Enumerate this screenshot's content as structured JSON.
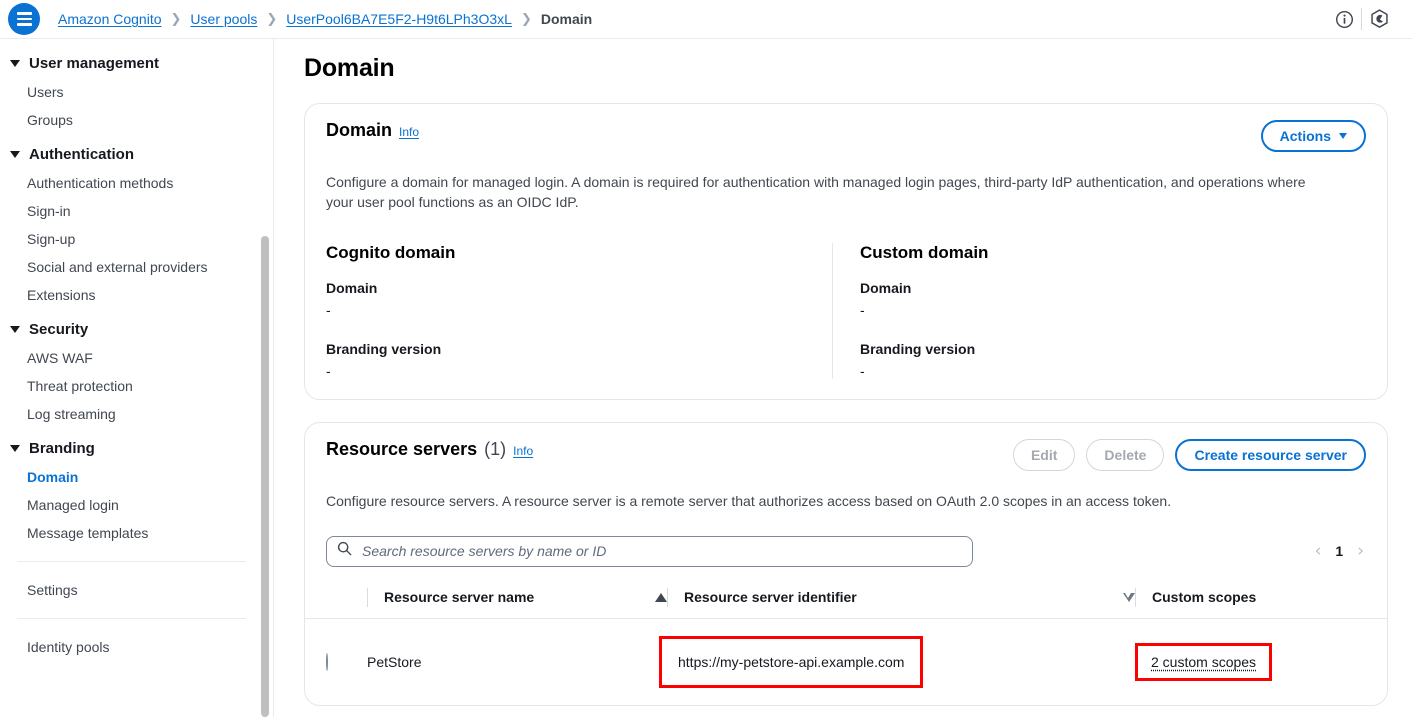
{
  "topbar": {
    "logo_name": "aws-cognito-menu-logo",
    "breadcrumbs": [
      {
        "label": "Amazon Cognito",
        "type": "link"
      },
      {
        "label": "User pools",
        "type": "link"
      },
      {
        "label": "UserPool6BA7E5F2-H9t6LPh3O3xL",
        "type": "link"
      },
      {
        "label": "Domain",
        "type": "current"
      }
    ],
    "separator": "❯",
    "icons": [
      {
        "name": "info-circle-icon",
        "glyph": "info"
      },
      {
        "name": "settings-hexagon-icon",
        "glyph": "hexagon"
      }
    ]
  },
  "sidebar": {
    "groups": [
      {
        "label": "User management",
        "items": [
          {
            "label": "Users",
            "active": false
          },
          {
            "label": "Groups",
            "active": false
          }
        ]
      },
      {
        "label": "Authentication",
        "items": [
          {
            "label": "Authentication methods",
            "active": false
          },
          {
            "label": "Sign-in",
            "active": false
          },
          {
            "label": "Sign-up",
            "active": false
          },
          {
            "label": "Social and external providers",
            "active": false
          },
          {
            "label": "Extensions",
            "active": false
          }
        ]
      },
      {
        "label": "Security",
        "items": [
          {
            "label": "AWS WAF",
            "active": false
          },
          {
            "label": "Threat protection",
            "active": false
          },
          {
            "label": "Log streaming",
            "active": false
          }
        ]
      },
      {
        "label": "Branding",
        "items": [
          {
            "label": "Domain",
            "active": true
          },
          {
            "label": "Managed login",
            "active": false
          },
          {
            "label": "Message templates",
            "active": false
          }
        ]
      }
    ],
    "standalone": [
      {
        "label": "Settings"
      },
      {
        "label": "Identity pools"
      }
    ]
  },
  "page": {
    "title": "Domain"
  },
  "domain_card": {
    "title": "Domain",
    "info_label": "Info",
    "actions_button": "Actions",
    "description": "Configure a domain for managed login. A domain is required for authentication with managed login pages, third-party IdP authentication, and operations where your user pool functions as an OIDC IdP.",
    "cognito": {
      "heading": "Cognito domain",
      "domain_label": "Domain",
      "domain_value": "-",
      "branding_label": "Branding version",
      "branding_value": "-"
    },
    "custom": {
      "heading": "Custom domain",
      "domain_label": "Domain",
      "domain_value": "-",
      "branding_label": "Branding version",
      "branding_value": "-"
    }
  },
  "resource_servers": {
    "title": "Resource servers",
    "count": "(1)",
    "info_label": "Info",
    "buttons": {
      "edit": "Edit",
      "delete": "Delete",
      "create": "Create resource server"
    },
    "description": "Configure resource servers. A resource server is a remote server that authorizes access based on OAuth 2.0 scopes in an access token.",
    "search": {
      "placeholder": "Search resource servers by name or ID",
      "value": ""
    },
    "pagination": {
      "prev": "‹",
      "page": "1",
      "next": "›"
    },
    "columns": [
      {
        "label": "Resource server name",
        "sort": "asc"
      },
      {
        "label": "Resource server identifier",
        "sort": "desc-outline"
      },
      {
        "label": "Custom scopes",
        "sort": "none"
      }
    ],
    "rows": [
      {
        "selected": false,
        "name": "PetStore",
        "identifier": "https://my-petstore-api.example.com",
        "scopes": "2 custom scopes"
      }
    ]
  },
  "colors": {
    "accent_blue": "#0972d3",
    "highlight_red": "#ff0000",
    "text_dark": "#16191f",
    "border_grey": "#e4e6e8"
  }
}
